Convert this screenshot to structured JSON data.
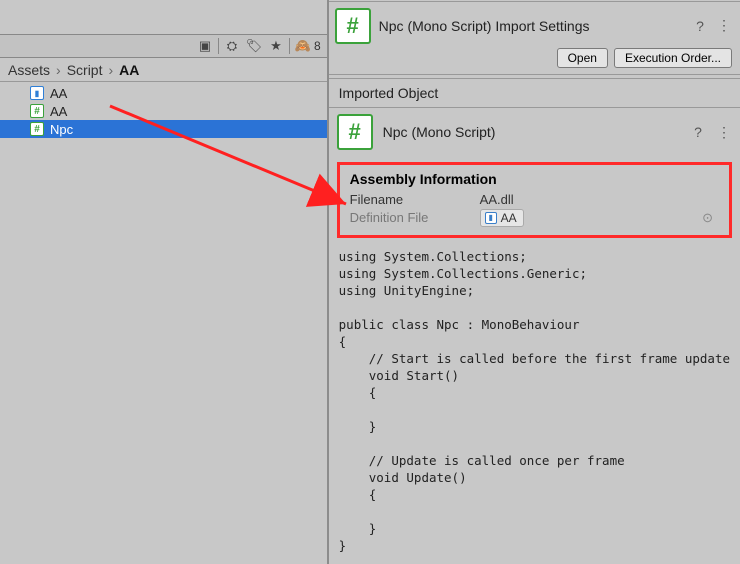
{
  "toolbar": {
    "hidden_items": "8"
  },
  "breadcrumb": {
    "items": [
      "Assets",
      "Script"
    ],
    "current": "AA"
  },
  "tree": {
    "items": [
      {
        "icon": "asmdef",
        "label": "AA",
        "selected": false
      },
      {
        "icon": "cs",
        "label": "AA",
        "selected": false
      },
      {
        "icon": "cs",
        "label": "Npc",
        "selected": true
      }
    ]
  },
  "inspector": {
    "title": "Npc (Mono Script) Import Settings",
    "buttons": {
      "open": "Open",
      "exec_order": "Execution Order..."
    },
    "imported_object_heading": "Imported Object",
    "object_title": "Npc (Mono Script)",
    "assembly": {
      "heading": "Assembly Information",
      "filename_label": "Filename",
      "filename": "AA.dll",
      "deffile_label": "Definition File",
      "deffile": "AA"
    },
    "code": "using System.Collections;\nusing System.Collections.Generic;\nusing UnityEngine;\n\npublic class Npc : MonoBehaviour\n{\n    // Start is called before the first frame update\n    void Start()\n    {\n\n    }\n\n    // Update is called once per frame\n    void Update()\n    {\n\n    }\n}"
  }
}
